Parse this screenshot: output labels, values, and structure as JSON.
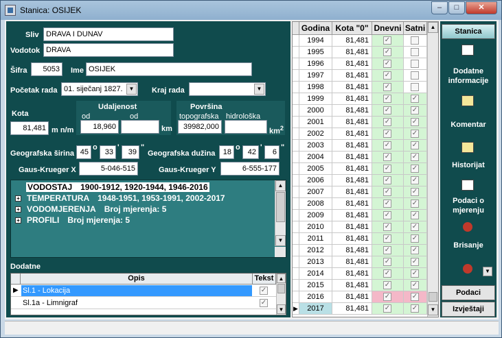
{
  "window": {
    "title": "Stanica: OSIJEK"
  },
  "form": {
    "sliv": {
      "label": "Sliv",
      "value": "DRAVA I DUNAV"
    },
    "vodotok": {
      "label": "Vodotok",
      "value": "DRAVA"
    },
    "sifra": {
      "label": "Šifra",
      "value": "5053"
    },
    "ime": {
      "label": "Ime",
      "value": "OSIJEK"
    },
    "pocetak": {
      "label": "Početak rada",
      "value": "01. siječanj 1827."
    },
    "kraj": {
      "label": "Kraj rada",
      "value": ""
    },
    "kota": {
      "label": "Kota",
      "value": "81,481",
      "unit": "m n/m"
    },
    "udaljenost": {
      "label": "Udaljenost",
      "sub1": "od",
      "sub2": "od",
      "value1": "18,960",
      "value2": "",
      "unit": "km"
    },
    "povrsina": {
      "label": "Površina",
      "sub1": "topografska",
      "sub2": "hidrološka",
      "value1": "39982,000",
      "value2": "",
      "unit": "km",
      "sup": "2"
    },
    "geo_sirina": {
      "label": "Geografska širina",
      "deg": "45",
      "min": "33",
      "sec": "39"
    },
    "geo_duzina": {
      "label": "Geografska dužina",
      "deg": "18",
      "min": "42",
      "sec": "6"
    },
    "gk_x": {
      "label": "Gaus-Krueger X",
      "value": "5-046-515"
    },
    "gk_y": {
      "label": "Gaus-Krueger Y",
      "value": "6-555-177"
    },
    "deg_sym": "o",
    "min_sym": "'",
    "sec_sym": "\""
  },
  "tree": [
    {
      "name": "VODOSTAJ",
      "detail": "1900-1912, 1920-1944, 1946-2016",
      "expanded": true
    },
    {
      "name": "TEMPERATURA",
      "detail": "1948-1951, 1953-1991, 2002-2017",
      "expanded": false
    },
    {
      "name": "VODOMJERENJA",
      "detail": "Broj mjerenja: 5",
      "expanded": false
    },
    {
      "name": "PROFILI",
      "detail": "Broj mjerenja: 5",
      "expanded": false
    }
  ],
  "dodatne": {
    "title": "Dodatne",
    "col_opis": "Opis",
    "col_tekst": "Tekst",
    "rows": [
      {
        "opis": "Sl.1 - Lokacija",
        "tekst": true,
        "selected": true
      },
      {
        "opis": "Sl.1a - Limnigraf",
        "tekst": true,
        "selected": false
      }
    ]
  },
  "years_table": {
    "headers": [
      "Godina",
      "Kota \"0\"",
      "Dnevni",
      "Satni"
    ],
    "check_mark": "✓",
    "rows": [
      {
        "godina": "1994",
        "kota": "81,481",
        "dnevni": true,
        "satni": false
      },
      {
        "godina": "1995",
        "kota": "81,481",
        "dnevni": true,
        "satni": false
      },
      {
        "godina": "1996",
        "kota": "81,481",
        "dnevni": true,
        "satni": false
      },
      {
        "godina": "1997",
        "kota": "81,481",
        "dnevni": true,
        "satni": false
      },
      {
        "godina": "1998",
        "kota": "81,481",
        "dnevni": true,
        "satni": false
      },
      {
        "godina": "1999",
        "kota": "81,481",
        "dnevni": true,
        "satni": true
      },
      {
        "godina": "2000",
        "kota": "81,481",
        "dnevni": true,
        "satni": true
      },
      {
        "godina": "2001",
        "kota": "81,481",
        "dnevni": true,
        "satni": true
      },
      {
        "godina": "2002",
        "kota": "81,481",
        "dnevni": true,
        "satni": true
      },
      {
        "godina": "2003",
        "kota": "81,481",
        "dnevni": true,
        "satni": true
      },
      {
        "godina": "2004",
        "kota": "81,481",
        "dnevni": true,
        "satni": true
      },
      {
        "godina": "2005",
        "kota": "81,481",
        "dnevni": true,
        "satni": true
      },
      {
        "godina": "2006",
        "kota": "81,481",
        "dnevni": true,
        "satni": true
      },
      {
        "godina": "2007",
        "kota": "81,481",
        "dnevni": true,
        "satni": true
      },
      {
        "godina": "2008",
        "kota": "81,481",
        "dnevni": true,
        "satni": true
      },
      {
        "godina": "2009",
        "kota": "81,481",
        "dnevni": true,
        "satni": true
      },
      {
        "godina": "2010",
        "kota": "81,481",
        "dnevni": true,
        "satni": true
      },
      {
        "godina": "2011",
        "kota": "81,481",
        "dnevni": true,
        "satni": true
      },
      {
        "godina": "2012",
        "kota": "81,481",
        "dnevni": true,
        "satni": true
      },
      {
        "godina": "2013",
        "kota": "81,481",
        "dnevni": true,
        "satni": true
      },
      {
        "godina": "2014",
        "kota": "81,481",
        "dnevni": true,
        "satni": true
      },
      {
        "godina": "2015",
        "kota": "81,481",
        "dnevni": true,
        "satni": true
      },
      {
        "godina": "2016",
        "kota": "81,481",
        "dnevni": true,
        "satni": true,
        "highlight": "pink"
      },
      {
        "godina": "2017",
        "kota": "81,481",
        "dnevni": true,
        "satni": true,
        "current": true
      }
    ]
  },
  "sidebar": {
    "header": "Stanica",
    "items": [
      {
        "label": "",
        "icon": "calendar-icon"
      },
      {
        "label": "Dodatne informacije",
        "icon": "notes-icon"
      },
      {
        "label": "Komentar",
        "icon": "note-edit-icon"
      },
      {
        "label": "Historijat",
        "icon": "table-icon"
      },
      {
        "label": "Podaci o mjerenju",
        "icon": "delete-icon"
      },
      {
        "label": "Brisanje",
        "icon": "delete-icon"
      }
    ],
    "buttons": [
      "Podaci",
      "Izvještaji"
    ]
  },
  "colors": {
    "panel": "#104b4d",
    "tree": "#2e7d80",
    "green_cell": "#d4f5d4",
    "pink_cell": "#f4b8c8",
    "current_cell": "#b9e0e6"
  }
}
